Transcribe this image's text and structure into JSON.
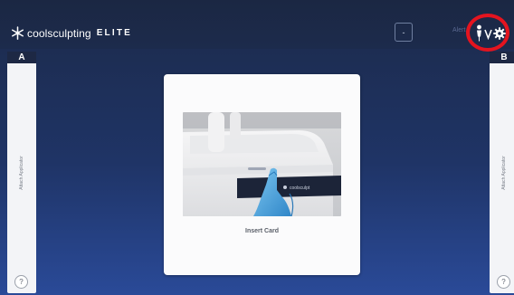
{
  "brand": {
    "name": "coolsculpting",
    "edition": "ELITE",
    "logo_icon": "snowflake-icon"
  },
  "topbar": {
    "square_button_label": "-",
    "faded_label": "Alert",
    "status_icons": [
      "person-icon",
      "gear-icon"
    ]
  },
  "panels": {
    "left": {
      "letter": "A",
      "label": "Attach Applicator",
      "help": "?"
    },
    "right": {
      "letter": "B",
      "label": "Attach Applicator",
      "help": "?"
    }
  },
  "main_card": {
    "caption": "Insert Card",
    "image": "insert-card-device-illustration"
  },
  "colors": {
    "background_top": "#1c2a4a",
    "background_bottom": "#2a4a98",
    "callout_ring": "#e4141f",
    "panel": "#f3f4f7",
    "glove": "#4aa6df"
  }
}
